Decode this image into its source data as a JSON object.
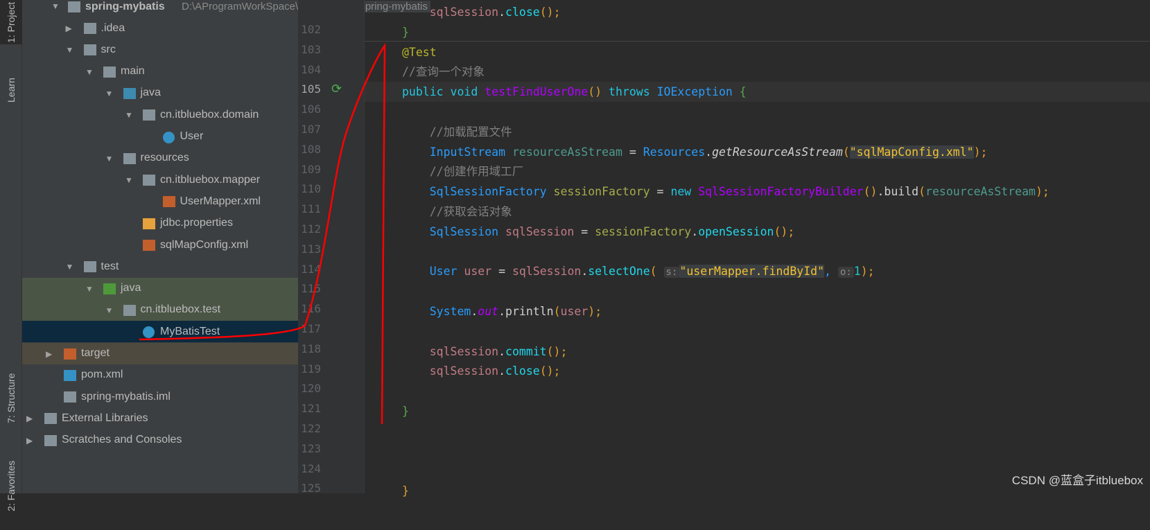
{
  "left_strip": {
    "project_tab": "1: Project",
    "learn_tab": "Learn",
    "structure_tab": "7: Structure",
    "favorites_tab": "2: Favorites"
  },
  "project": {
    "name": "spring-mybatis",
    "path": "D:\\AProgramWorkSpace\\idea\\practice\\spring-mybatis"
  },
  "tree": [
    {
      "label": ".idea",
      "level": 0,
      "arrow": "right",
      "icon": "folder",
      "color": "#87939a"
    },
    {
      "label": "src",
      "level": 0,
      "arrow": "down",
      "icon": "folder",
      "color": "#87939a"
    },
    {
      "label": "main",
      "level": 1,
      "arrow": "down",
      "icon": "folder",
      "color": "#87939a"
    },
    {
      "label": "java",
      "level": 2,
      "arrow": "down",
      "icon": "source-folder",
      "color": "#3d8bb0"
    },
    {
      "label": "cn.itbluebox.domain",
      "level": 3,
      "arrow": "down",
      "icon": "package",
      "color": "#87939a"
    },
    {
      "label": "User",
      "level": 4,
      "arrow": "",
      "icon": "class",
      "color": "#3592c4"
    },
    {
      "label": "resources",
      "level": 2,
      "arrow": "down",
      "icon": "resources-folder",
      "color": "#87939a"
    },
    {
      "label": "cn.itbluebox.mapper",
      "level": 3,
      "arrow": "down",
      "icon": "package",
      "color": "#87939a"
    },
    {
      "label": "UserMapper.xml",
      "level": 4,
      "arrow": "",
      "icon": "xml-file",
      "color": "#c35f2c"
    },
    {
      "label": "jdbc.properties",
      "level": 3,
      "arrow": "",
      "icon": "properties-file",
      "color": "#e6a23c"
    },
    {
      "label": "sqlMapConfig.xml",
      "level": 3,
      "arrow": "",
      "icon": "xml-file",
      "color": "#c35f2c"
    },
    {
      "label": "test",
      "level": 0,
      "arrow": "down",
      "icon": "folder",
      "color": "#87939a"
    },
    {
      "label": "java",
      "level": 1,
      "arrow": "down",
      "icon": "test-folder",
      "color": "#4e9a3a",
      "highlight": "#4b5546"
    },
    {
      "label": "cn.itbluebox.test",
      "level": 2,
      "arrow": "down",
      "icon": "package",
      "color": "#87939a",
      "highlight": "#4b5546"
    },
    {
      "label": "MyBatisTest",
      "level": 3,
      "arrow": "",
      "icon": "test-class",
      "color": "#3592c4",
      "highlight": "#0d293e"
    },
    {
      "label": "target",
      "level": -1,
      "arrow": "right",
      "icon": "folder",
      "color": "#c35f2c",
      "highlight": "#4f4a3f"
    },
    {
      "label": "pom.xml",
      "level": -1,
      "arrow": "",
      "icon": "maven",
      "color": "#3592c4"
    },
    {
      "label": "spring-mybatis.iml",
      "level": -1,
      "arrow": "",
      "icon": "iml-file",
      "color": "#87939a"
    },
    {
      "label": "External Libraries",
      "level": -2,
      "arrow": "right",
      "icon": "libraries",
      "color": "#87939a"
    },
    {
      "label": "Scratches and Consoles",
      "level": -2,
      "arrow": "right",
      "icon": "scratches",
      "color": "#87939a"
    }
  ],
  "editor": {
    "line_numbers": [
      "102",
      "103",
      "104",
      "105",
      "106",
      "107",
      "108",
      "109",
      "110",
      "111",
      "112",
      "113",
      "114",
      "115",
      "116",
      "117",
      "118",
      "119",
      "120",
      "121",
      "122",
      "123",
      "124",
      "125"
    ],
    "current_line": "105",
    "lines": [
      [
        [
          "ss",
          "    sqlSession"
        ],
        [
          "pl",
          "."
        ],
        [
          "mc",
          "close"
        ],
        [
          "pa",
          "()"
        ],
        [
          "pa",
          ";"
        ]
      ],
      [
        [
          "br",
          "}"
        ]
      ],
      [
        [
          "an",
          "@Test"
        ]
      ],
      [
        [
          "cm",
          "//查询一个对象"
        ]
      ],
      [
        [
          "kw",
          "public void "
        ],
        [
          "fn",
          "testFindUserOne"
        ],
        [
          "pa",
          "()"
        ],
        [
          "kw",
          " throws "
        ],
        [
          "ty",
          "IOException"
        ],
        [
          "br",
          " {"
        ]
      ],
      [],
      [
        [
          "cm",
          "    //加载配置文件"
        ]
      ],
      [
        [
          "ty",
          "    InputStream "
        ],
        [
          "va",
          "resourceAsStream"
        ],
        [
          "pl",
          " = "
        ],
        [
          "ty",
          "Resources"
        ],
        [
          "pl",
          "."
        ],
        [
          "pl it",
          "getResourceAsStream"
        ],
        [
          "pa",
          "("
        ],
        [
          "st sbg",
          "\"sqlMapConfig.xml\""
        ],
        [
          "pa",
          ");"
        ]
      ],
      [
        [
          "cm",
          "    //创建作用域工厂"
        ]
      ],
      [
        [
          "ty",
          "    SqlSessionFactory "
        ],
        [
          "sf",
          "sessionFactory"
        ],
        [
          "pl",
          " = "
        ],
        [
          "kw",
          "new "
        ],
        [
          "fn",
          "SqlSessionFactoryBuilder"
        ],
        [
          "pa",
          "()"
        ],
        [
          "pl",
          ".build"
        ],
        [
          "pa",
          "("
        ],
        [
          "va",
          "resourceAsStream"
        ],
        [
          "pa",
          ");"
        ]
      ],
      [
        [
          "cm",
          "    //获取会话对象"
        ]
      ],
      [
        [
          "ty",
          "    SqlSession "
        ],
        [
          "ss",
          "sqlSession"
        ],
        [
          "pl",
          " = "
        ],
        [
          "sf",
          "sessionFactory"
        ],
        [
          "pl",
          "."
        ],
        [
          "mc",
          "openSession"
        ],
        [
          "pa",
          "();"
        ]
      ],
      [],
      [
        [
          "ty",
          "    User "
        ],
        [
          "ss",
          "user"
        ],
        [
          "pl",
          " = "
        ],
        [
          "ss",
          "sqlSession"
        ],
        [
          "pl",
          "."
        ],
        [
          "mc",
          "selectOne"
        ],
        [
          "pa",
          "( "
        ],
        [
          "hint",
          "s:"
        ],
        [
          "st sbg",
          "\"userMapper.findById\""
        ],
        [
          "ty",
          ", "
        ],
        [
          "hint",
          "o:"
        ],
        [
          "num",
          "1"
        ],
        [
          "pa",
          ");"
        ]
      ],
      [],
      [
        [
          "ty",
          "    System"
        ],
        [
          "pl",
          "."
        ],
        [
          "fn it",
          "out"
        ],
        [
          "pl",
          ".println"
        ],
        [
          "pa",
          "("
        ],
        [
          "ss",
          "user"
        ],
        [
          "pa",
          ");"
        ]
      ],
      [],
      [
        [
          "ss",
          "    sqlSession"
        ],
        [
          "pl",
          "."
        ],
        [
          "mc",
          "commit"
        ],
        [
          "pa",
          "();"
        ]
      ],
      [
        [
          "ss",
          "    sqlSession"
        ],
        [
          "pl",
          "."
        ],
        [
          "mc",
          "close"
        ],
        [
          "pa",
          "();"
        ]
      ],
      [],
      [
        [
          "br",
          "}"
        ]
      ],
      [],
      [],
      [],
      [
        [
          "pa",
          "}"
        ]
      ]
    ]
  },
  "watermark": "CSDN @蓝盒子itbluebox",
  "annotation_color": "#ff0000"
}
